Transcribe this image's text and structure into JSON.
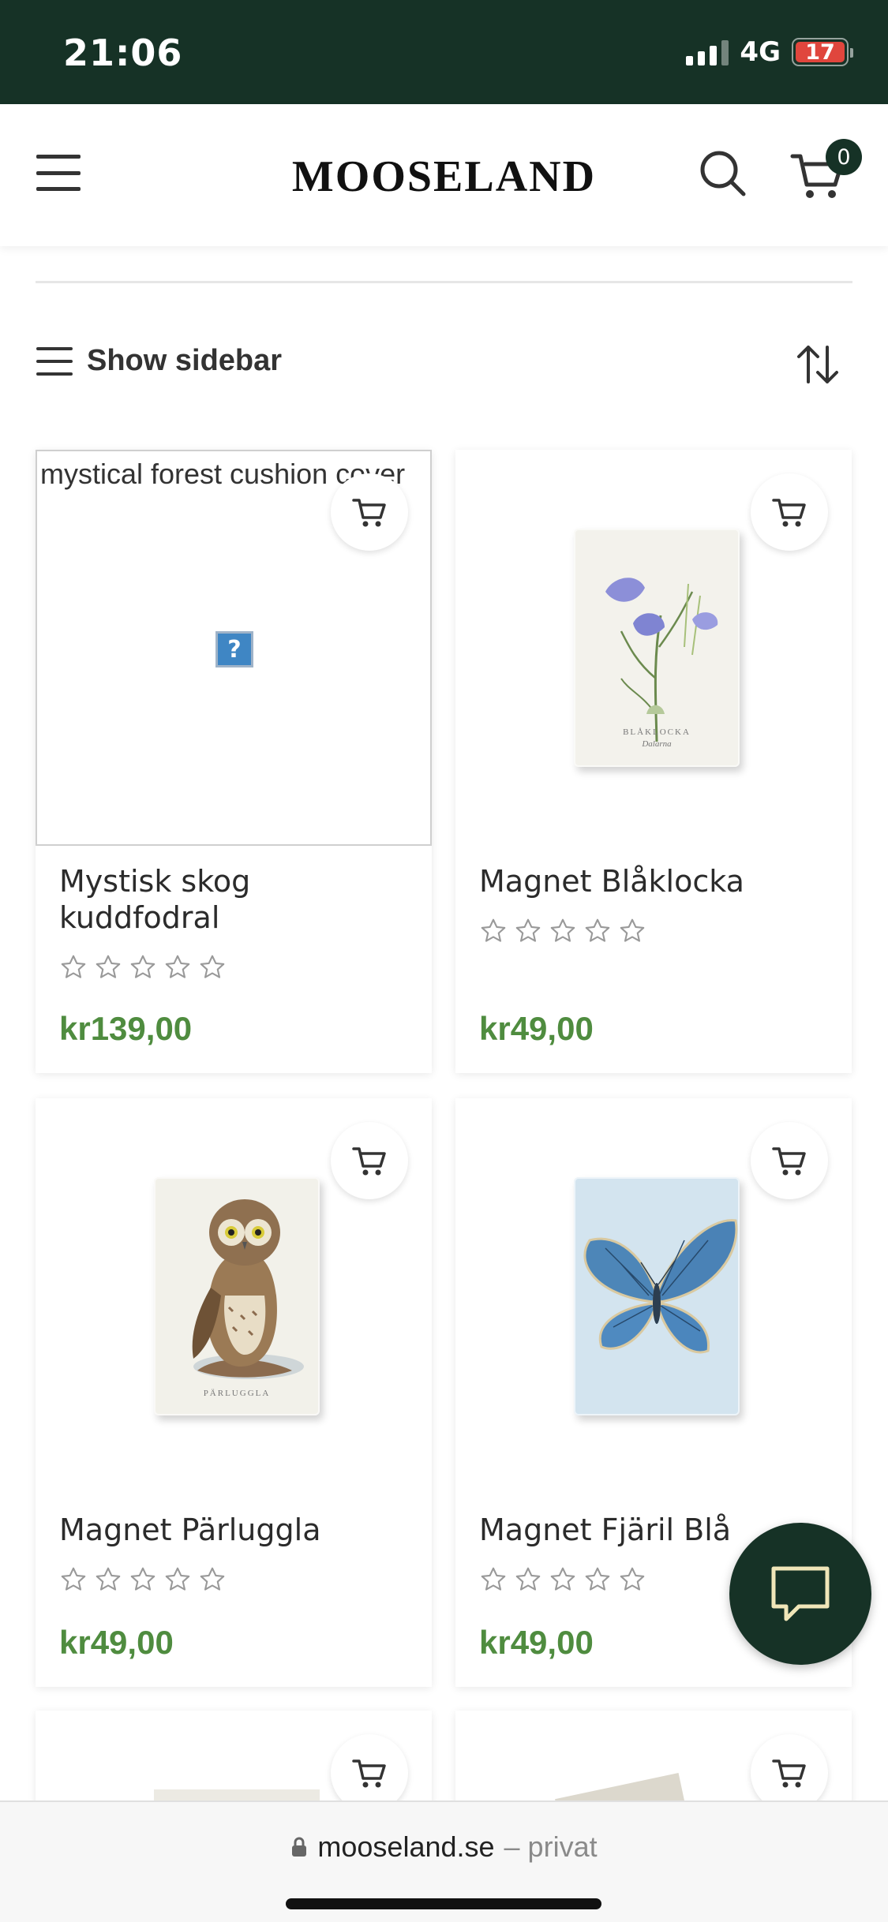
{
  "status": {
    "time": "21:06",
    "network": "4G",
    "battery": "17"
  },
  "header": {
    "logo": "MOOSELAND",
    "cart_count": "0"
  },
  "toolbar": {
    "sidebar_label": "Show sidebar"
  },
  "products": [
    {
      "title": "Mystisk skog kuddfodral",
      "price": "kr139,00",
      "image_alt": "mystical forest cushion cover",
      "rating_stars": 0
    },
    {
      "title": "Magnet Blåklocka",
      "price": "kr49,00",
      "image_caption": "BLÅKLOCKA",
      "image_subcaption": "Dalarna",
      "rating_stars": 0
    },
    {
      "title": "Magnet Pärluggla",
      "price": "kr49,00",
      "image_caption": "PÄRLUGGLA",
      "rating_stars": 0
    },
    {
      "title": "Magnet Fjäril Blå",
      "price": "kr49,00",
      "rating_stars": 0
    }
  ],
  "address_bar": {
    "domain": "mooseland.se",
    "mode": "– privat"
  },
  "colors": {
    "brand_dark_green": "#163226",
    "price_green": "#4f8c3f",
    "battery_red": "#e0463d"
  }
}
